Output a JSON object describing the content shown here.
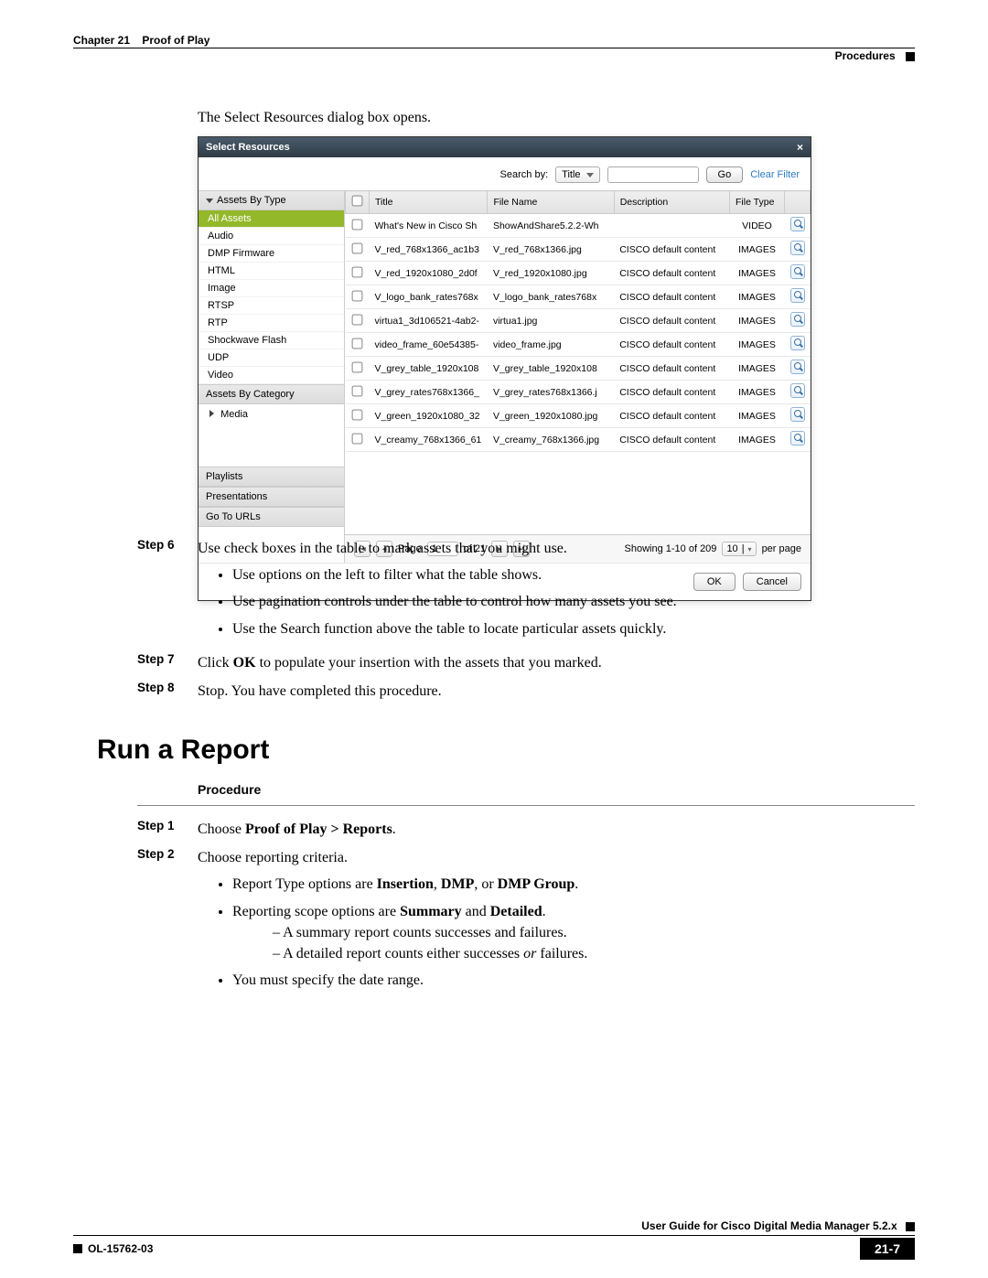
{
  "header": {
    "chapter_num": "Chapter 21",
    "chapter_title": "Proof of Play",
    "sub": "Procedures"
  },
  "intro": "The Select Resources dialog box opens.",
  "dialog": {
    "title": "Select Resources",
    "search_label": "Search by:",
    "search_select": "Title",
    "go_label": "Go",
    "clear_label": "Clear Filter",
    "sidebar": {
      "header1": "Assets By Type",
      "items": [
        "All Assets",
        "Audio",
        "DMP Firmware",
        "HTML",
        "Image",
        "RTSP",
        "RTP",
        "Shockwave Flash",
        "UDP",
        "Video"
      ],
      "header2": "Assets By Category",
      "media": "Media",
      "sections": [
        "Playlists",
        "Presentations",
        "Go To URLs"
      ]
    },
    "columns": [
      "",
      "Title",
      "File Name",
      "Description",
      "File Type",
      ""
    ],
    "rows": [
      {
        "title": "What's New in Cisco Sh",
        "file": "ShowAndShare5.2.2-Wh",
        "desc": "",
        "type": "VIDEO"
      },
      {
        "title": "V_red_768x1366_ac1b3",
        "file": "V_red_768x1366.jpg",
        "desc": "CISCO default content",
        "type": "IMAGES"
      },
      {
        "title": "V_red_1920x1080_2d0f",
        "file": "V_red_1920x1080.jpg",
        "desc": "CISCO default content",
        "type": "IMAGES"
      },
      {
        "title": "V_logo_bank_rates768x",
        "file": "V_logo_bank_rates768x",
        "desc": "CISCO default content",
        "type": "IMAGES"
      },
      {
        "title": "virtua1_3d106521-4ab2-",
        "file": "virtua1.jpg",
        "desc": "CISCO default content",
        "type": "IMAGES"
      },
      {
        "title": "video_frame_60e54385-",
        "file": "video_frame.jpg",
        "desc": "CISCO default content",
        "type": "IMAGES"
      },
      {
        "title": "V_grey_table_1920x108",
        "file": "V_grey_table_1920x108",
        "desc": "CISCO default content",
        "type": "IMAGES"
      },
      {
        "title": "V_grey_rates768x1366_",
        "file": "V_grey_rates768x1366.j",
        "desc": "CISCO default content",
        "type": "IMAGES"
      },
      {
        "title": "V_green_1920x1080_32",
        "file": "V_green_1920x1080.jpg",
        "desc": "CISCO default content",
        "type": "IMAGES"
      },
      {
        "title": "V_creamy_768x1366_61",
        "file": "V_creamy_768x1366.jpg",
        "desc": "CISCO default content",
        "type": "IMAGES"
      }
    ],
    "pager": {
      "page_label": "Page",
      "page_value": "1",
      "of_label": "of 21",
      "showing": "Showing 1-10 of 209",
      "per_value": "10",
      "per_label": "per page"
    },
    "ok": "OK",
    "cancel": "Cancel"
  },
  "stepsA": {
    "s6_label": "Step 6",
    "s6_text": "Use check boxes in the table to mark assets that you might use.",
    "s6_b1": "Use options on the left to filter what the table shows.",
    "s6_b2": "Use pagination controls under the table to control how many assets you see.",
    "s6_b3": "Use the Search function above the table to locate particular assets quickly.",
    "s7_label": "Step 7",
    "s7_text_pre": "Click ",
    "s7_bold": "OK",
    "s7_text_post": " to populate your insertion with the assets that you marked.",
    "s8_label": "Step 8",
    "s8_text": "Stop. You have completed this procedure."
  },
  "section2": {
    "heading": "Run a Report",
    "procedure": "Procedure",
    "s1_label": "Step 1",
    "s1_pre": "Choose ",
    "s1_bold": "Proof of Play > Reports",
    "s1_post": ".",
    "s2_label": "Step 2",
    "s2_text": "Choose reporting criteria.",
    "s2_b1_pre": "Report Type options are ",
    "s2_b1_b1": "Insertion",
    "s2_b1_m1": ", ",
    "s2_b1_b2": "DMP",
    "s2_b1_m2": ", or ",
    "s2_b1_b3": "DMP Group",
    "s2_b1_post": ".",
    "s2_b2_pre": "Reporting scope options are ",
    "s2_b2_b1": "Summary",
    "s2_b2_m": " and ",
    "s2_b2_b2": "Detailed",
    "s2_b2_post": ".",
    "s2_sub1": "A summary report counts successes and failures.",
    "s2_sub2_pre": "A detailed report counts either successes ",
    "s2_sub2_i": "or",
    "s2_sub2_post": " failures.",
    "s2_b3": "You must specify the date range."
  },
  "footer": {
    "guide": "User Guide for Cisco Digital Media Manager 5.2.x",
    "doc": "OL-15762-03",
    "page": "21-7"
  }
}
